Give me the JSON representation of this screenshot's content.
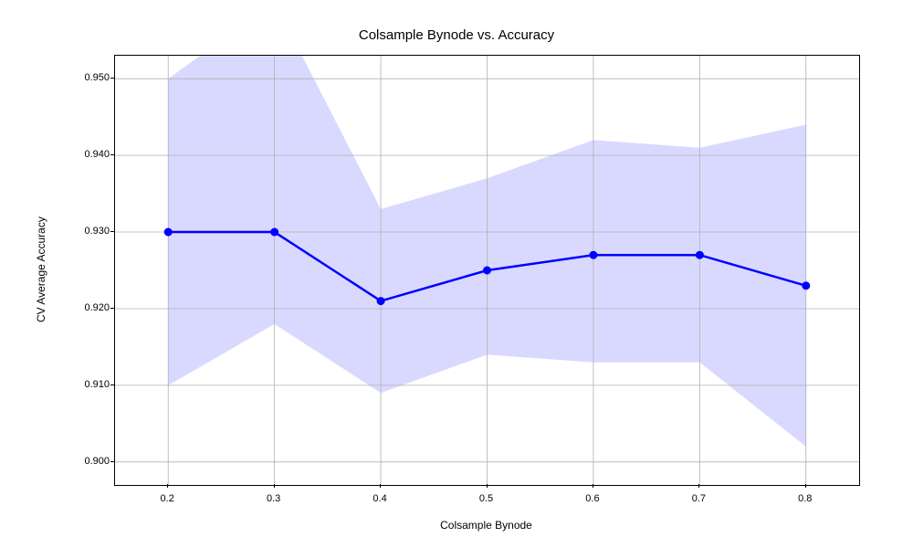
{
  "chart_data": {
    "type": "line",
    "title": "Colsample Bynode vs. Accuracy",
    "xlabel": "Colsample Bynode",
    "ylabel": "CV Average Accuracy",
    "x": [
      0.2,
      0.3,
      0.4,
      0.5,
      0.6,
      0.7,
      0.8
    ],
    "values": [
      0.93,
      0.93,
      0.921,
      0.925,
      0.927,
      0.927,
      0.923
    ],
    "band_upper": [
      0.95,
      0.96,
      0.933,
      0.937,
      0.942,
      0.941,
      0.944
    ],
    "band_lower": [
      0.91,
      0.918,
      0.909,
      0.914,
      0.913,
      0.913,
      0.902
    ],
    "xlim": [
      0.15,
      0.85
    ],
    "ylim": [
      0.897,
      0.953
    ],
    "xticks": [
      0.2,
      0.3,
      0.4,
      0.5,
      0.6,
      0.7,
      0.8
    ],
    "yticks": [
      0.9,
      0.91,
      0.92,
      0.93,
      0.94,
      0.95
    ],
    "xtick_labels": [
      "0.2",
      "0.3",
      "0.4",
      "0.5",
      "0.6",
      "0.7",
      "0.8"
    ],
    "ytick_labels": [
      "0.900",
      "0.910",
      "0.920",
      "0.930",
      "0.940",
      "0.950"
    ],
    "line_color": "#0000ff",
    "band_color": "rgba(0,0,255,0.15)"
  }
}
